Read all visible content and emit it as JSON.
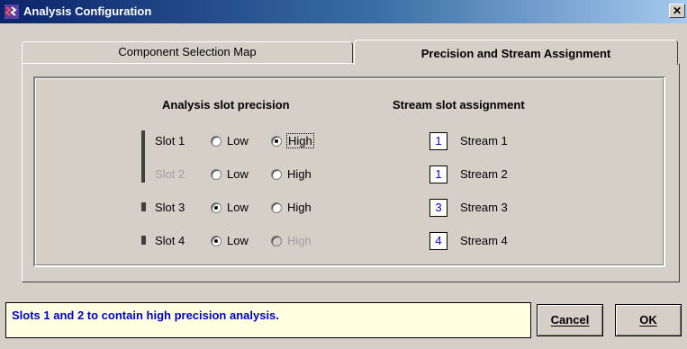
{
  "window": {
    "title": "Analysis Configuration",
    "close_glyph": "✕",
    "icon": "app-logo-icon"
  },
  "tabs": [
    {
      "label": "Component Selection Map",
      "active": false
    },
    {
      "label": "Precision and Stream Assignment",
      "active": true
    }
  ],
  "precision": {
    "header": "Analysis slot precision",
    "low_label": "Low",
    "high_label": "High",
    "slots": [
      {
        "label": "Slot 1",
        "selected": "High",
        "enabled": true,
        "high_enabled": true
      },
      {
        "label": "Slot 2",
        "selected": "none",
        "enabled": false,
        "high_enabled": true
      },
      {
        "label": "Slot 3",
        "selected": "Low",
        "enabled": true,
        "high_enabled": true
      },
      {
        "label": "Slot 4",
        "selected": "Low",
        "enabled": true,
        "high_enabled": false
      }
    ]
  },
  "streams": {
    "header": "Stream slot assignment",
    "rows": [
      {
        "value": "1",
        "label": "Stream 1"
      },
      {
        "value": "1",
        "label": "Stream 2"
      },
      {
        "value": "3",
        "label": "Stream 3"
      },
      {
        "value": "4",
        "label": "Stream 4"
      }
    ]
  },
  "status": {
    "message": "Slots 1 and 2 to contain high precision analysis."
  },
  "buttons": {
    "cancel": "Cancel",
    "ok": "OK"
  },
  "colors": {
    "face": "#d4d0c8",
    "status_bg": "#ffffe1",
    "status_text": "#0000c0",
    "title_start": "#0a246a",
    "title_end": "#a6caf0"
  }
}
